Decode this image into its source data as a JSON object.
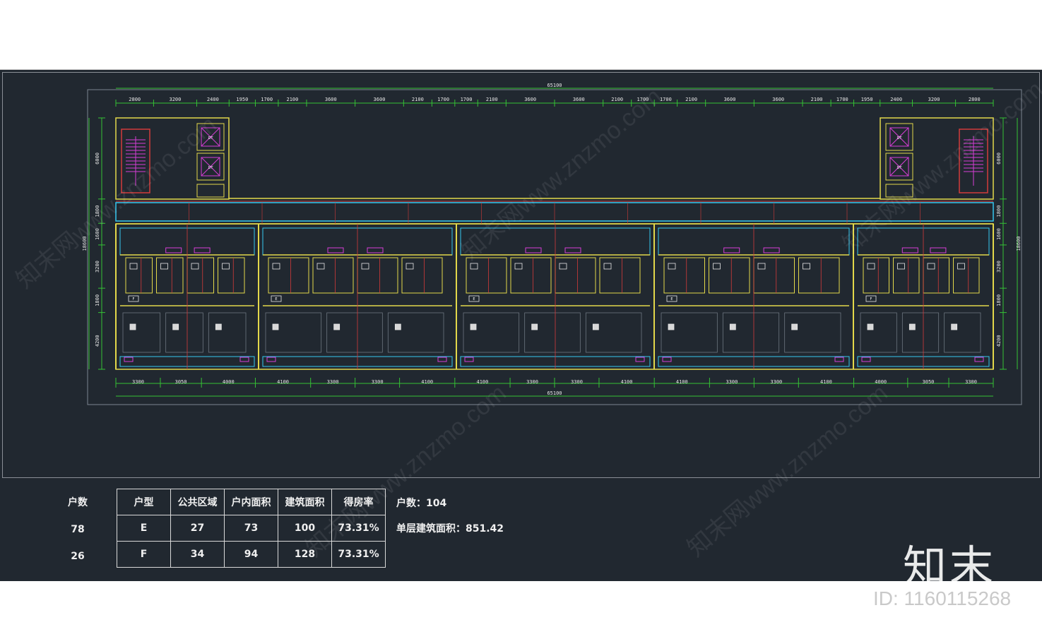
{
  "plan": {
    "top_dims": [
      "2800",
      "3200",
      "2400",
      "1950",
      "1700",
      "2100",
      "3600",
      "3600",
      "2100",
      "1700",
      "1700",
      "2100",
      "3600",
      "3600",
      "2100",
      "1700",
      "1700",
      "2100",
      "3600",
      "3600",
      "2100",
      "1700",
      "1950",
      "2400",
      "3200",
      "2800"
    ],
    "bottom_dims": [
      "3300",
      "3050",
      "4000",
      "4100",
      "3300",
      "3300",
      "4100",
      "4100",
      "3300",
      "3300",
      "4100",
      "4100",
      "3300",
      "3300",
      "4100",
      "4000",
      "3050",
      "3300"
    ],
    "overall_width": "65100",
    "left_dims": [
      "6000",
      "1800",
      "1600",
      "3200",
      "1800",
      "4200"
    ],
    "right_dims": [
      "6000",
      "1800",
      "1600",
      "3200",
      "1800",
      "4200"
    ],
    "overall_depth": "18600",
    "unit_tag_e": "E",
    "unit_tag_f": "F",
    "elevator_tag": "DT"
  },
  "unit_counts": {
    "header": "户数",
    "rows": [
      "78",
      "26"
    ]
  },
  "area_table": {
    "headers": [
      "户型",
      "公共区域",
      "户内面积",
      "建筑面积",
      "得房率"
    ],
    "rows": [
      [
        "E",
        "27",
        "73",
        "100",
        "73.31%"
      ],
      [
        "F",
        "34",
        "94",
        "128",
        "73.31%"
      ]
    ]
  },
  "summary": {
    "households": "户数：104",
    "floor_area": "单层建筑面积：851.42"
  },
  "brand": {
    "logo": "知末",
    "id": "ID: 1160115268",
    "watermark": "知末网www.znzmo.com"
  }
}
